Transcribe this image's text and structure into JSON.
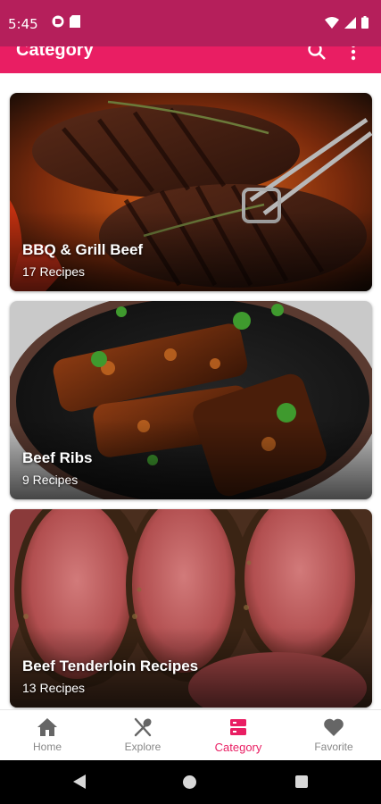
{
  "status": {
    "time": "5:45"
  },
  "app_bar": {
    "title": "Category"
  },
  "categories": [
    {
      "title": "BBQ & Grill Beef",
      "count": "17 Recipes"
    },
    {
      "title": "Beef Ribs",
      "count": "9 Recipes"
    },
    {
      "title": "Beef Tenderloin Recipes",
      "count": "13 Recipes"
    }
  ],
  "bottom_nav": {
    "items": [
      {
        "label": "Home",
        "icon": "home-icon"
      },
      {
        "label": "Explore",
        "icon": "fork-spoon-icon"
      },
      {
        "label": "Category",
        "icon": "category-icon"
      },
      {
        "label": "Favorite",
        "icon": "heart-icon"
      }
    ],
    "active": "Category"
  },
  "colors": {
    "status_bar": "#b51f5b",
    "app_bar": "#e91e63",
    "accent": "#e91e63",
    "nav_inactive": "#888888"
  }
}
